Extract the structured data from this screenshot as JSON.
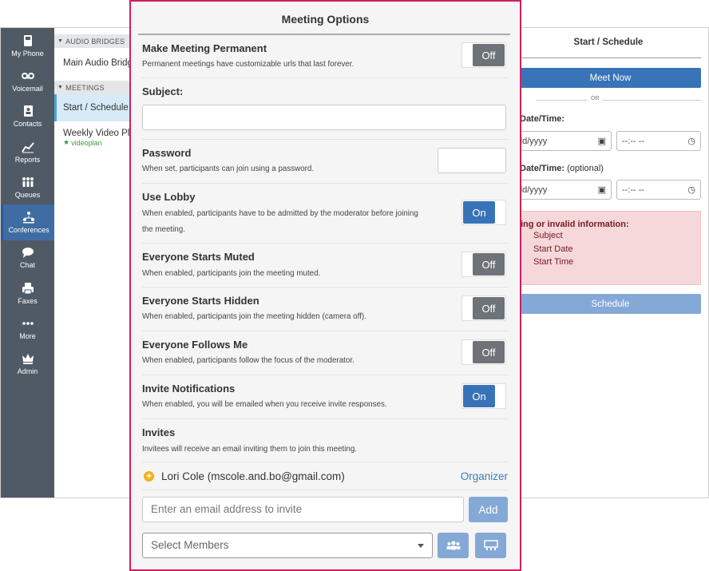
{
  "nav": {
    "items": [
      {
        "label": "My Phone",
        "icon": "phone-icon"
      },
      {
        "label": "Voicemail",
        "icon": "voicemail-icon"
      },
      {
        "label": "Contacts",
        "icon": "contacts-icon"
      },
      {
        "label": "Reports",
        "icon": "reports-icon"
      },
      {
        "label": "Queues",
        "icon": "queues-icon"
      },
      {
        "label": "Conferences",
        "icon": "conferences-icon",
        "active": true
      },
      {
        "label": "Chat",
        "icon": "chat-icon"
      },
      {
        "label": "Faxes",
        "icon": "fax-icon"
      },
      {
        "label": "More",
        "icon": "more-icon"
      },
      {
        "label": "Admin",
        "icon": "crown-icon"
      }
    ]
  },
  "subnav": {
    "audio_header": "AUDIO BRIDGES",
    "audio_item": "Main Audio Bridge",
    "meetings_header": "MEETINGS",
    "meeting_active": "Start / Schedule",
    "meeting_item": "Weekly Video Plan",
    "meeting_item_tag": "videoplan"
  },
  "schedule": {
    "title": "Start / Schedule",
    "meet_now": "Meet Now",
    "or": "OR",
    "start_label": "Date/Time:",
    "end_label": "Date/Time:",
    "end_optional": "(optional)",
    "date_placeholder": "dd/yyyy",
    "time_placeholder": "--:-- --",
    "alert_title": "ing or invalid information:",
    "alert_items": [
      "Subject",
      "Start Date",
      "Start Time"
    ],
    "schedule_btn": "Schedule"
  },
  "modal": {
    "title": "Meeting Options",
    "permanent": {
      "title": "Make Meeting Permanent",
      "desc": "Permanent meetings have customizable urls that last forever.",
      "state": "Off"
    },
    "subject": {
      "title": "Subject:",
      "value": ""
    },
    "password": {
      "title": "Password",
      "desc": "When set, participants can join using a password.",
      "value": ""
    },
    "lobby": {
      "title": "Use Lobby",
      "desc": "When enabled, participants have to be admitted by the moderator before joining the meeting.",
      "state": "On"
    },
    "muted": {
      "title": "Everyone Starts Muted",
      "desc": "When enabled, participants join the meeting muted.",
      "state": "Off"
    },
    "hidden": {
      "title": "Everyone Starts Hidden",
      "desc": "When enabled, participants join the meeting hidden (camera off).",
      "state": "Off"
    },
    "follows": {
      "title": "Everyone Follows Me",
      "desc": "When enabled, participants follow the focus of the moderator.",
      "state": "Off"
    },
    "notify": {
      "title": "Invite Notifications",
      "desc": "When enabled, you will be emailed when you receive invite responses.",
      "state": "On"
    },
    "invites": {
      "title": "Invites",
      "desc": "Invitees will receive an email inviting them to join this meeting.",
      "person": "Lori Cole (mscole.and.bo@gmail.com)",
      "role": "Organizer",
      "email_placeholder": "Enter an email address to invite",
      "add": "Add",
      "select_placeholder": "Select Members"
    }
  },
  "colors": {
    "accent": "#3873b7",
    "modal_border": "#d01f5d",
    "nav_bg": "#4f5a65",
    "alert_bg": "#f6d7da"
  }
}
